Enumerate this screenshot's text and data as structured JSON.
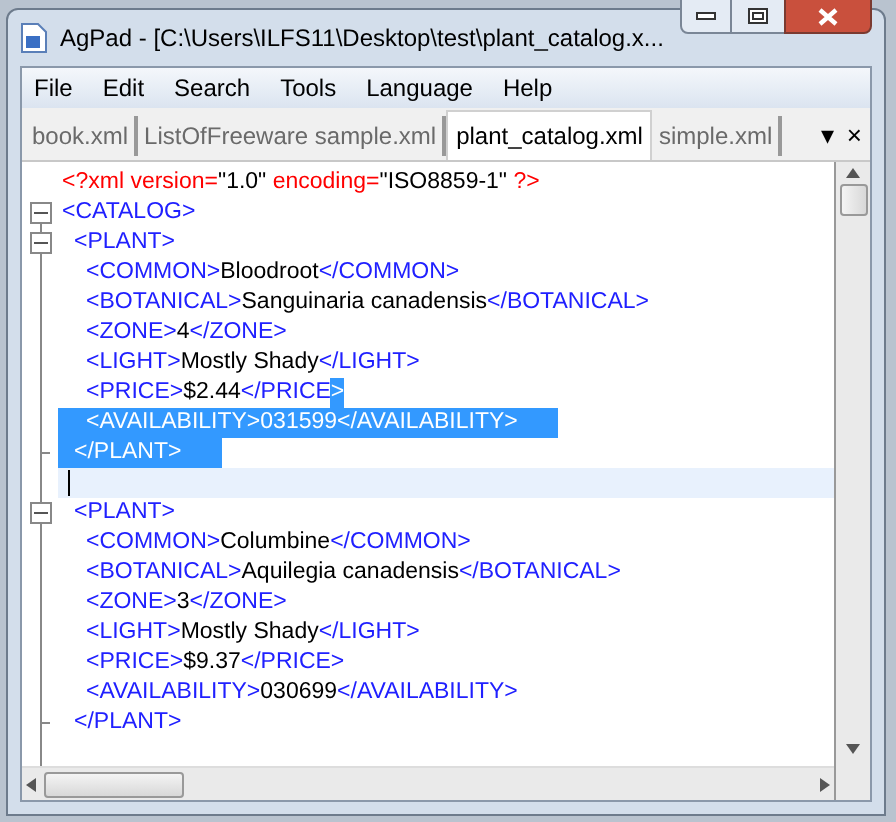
{
  "window": {
    "title": "AgPad - [C:\\Users\\ILFS11\\Desktop\\test\\plant_catalog.x..."
  },
  "menu": [
    "File",
    "Edit",
    "Search",
    "Tools",
    "Language",
    "Help"
  ],
  "tabs": [
    {
      "label": "book.xml",
      "selected": false
    },
    {
      "label": "ListOfFreeware sample.xml",
      "selected": false
    },
    {
      "label": "plant_catalog.xml",
      "selected": true
    },
    {
      "label": "simple.xml",
      "selected": false
    }
  ],
  "tab_controls": [
    "▾",
    "×"
  ],
  "editor": {
    "lines": [
      {
        "kind": "declaration",
        "selected": false,
        "tokens": [
          {
            "t": "<?xml version=",
            "kind": "decl",
            "selected": false
          },
          {
            "t": "\"1.0\"",
            "kind": "value",
            "selected": false
          },
          {
            "t": " encoding=",
            "kind": "decl",
            "selected": false
          },
          {
            "t": "\"ISO8859-1\"",
            "kind": "value",
            "selected": false
          },
          {
            "t": " ?>",
            "kind": "decl",
            "selected": false
          }
        ]
      },
      {
        "kind": "element",
        "expanded": true,
        "selected": false,
        "tokens": [
          {
            "t": "<CATALOG>",
            "kind": "tag",
            "selected": false
          }
        ],
        "children": [
          {
            "kind": "element",
            "expanded": true,
            "selected": false,
            "tokens": [
              {
                "t": "<PLANT>",
                "kind": "tag",
                "selected": false
              }
            ],
            "children": [
              {
                "kind": "line",
                "selected": false,
                "tokens": [
                  {
                    "t": "<COMMON>",
                    "kind": "tag",
                    "selected": false
                  },
                  {
                    "t": "Bloodroot",
                    "kind": "text",
                    "selected": false
                  },
                  {
                    "t": "</COMMON>",
                    "kind": "tag",
                    "selected": false
                  }
                ]
              },
              {
                "kind": "line",
                "selected": false,
                "tokens": [
                  {
                    "t": "<BOTANICAL>",
                    "kind": "tag",
                    "selected": false
                  },
                  {
                    "t": "Sanguinaria canadensis",
                    "kind": "text",
                    "selected": false
                  },
                  {
                    "t": "</BOTANICAL>",
                    "kind": "tag",
                    "selected": false
                  }
                ]
              },
              {
                "kind": "line",
                "selected": false,
                "tokens": [
                  {
                    "t": "<ZONE>",
                    "kind": "tag",
                    "selected": false
                  },
                  {
                    "t": "4",
                    "kind": "text",
                    "selected": false
                  },
                  {
                    "t": "</ZONE>",
                    "kind": "tag",
                    "selected": false
                  }
                ]
              },
              {
                "kind": "line",
                "selected": false,
                "tokens": [
                  {
                    "t": "<LIGHT>",
                    "kind": "tag",
                    "selected": false
                  },
                  {
                    "t": "Mostly Shady",
                    "kind": "text",
                    "selected": false
                  },
                  {
                    "t": "</LIGHT>",
                    "kind": "tag",
                    "selected": false
                  }
                ]
              },
              {
                "kind": "line",
                "selected": false,
                "tokens": [
                  {
                    "t": "<PRICE>",
                    "kind": "tag",
                    "selected": false
                  },
                  {
                    "t": "$2.44",
                    "kind": "text",
                    "selected": false
                  },
                  {
                    "t": "</PRICE",
                    "kind": "tag",
                    "selected": false
                  },
                  {
                    "t": ">",
                    "kind": "tag",
                    "selected": true
                  }
                ]
              },
              {
                "kind": "line",
                "selected": true,
                "tokens": [
                  {
                    "t": "<AVAILABILITY>031599</AVAILABILITY>",
                    "kind": "tag",
                    "selected": true
                  }
                ]
              },
              {
                "kind": "close",
                "selected": true,
                "tokens": [
                  {
                    "t": "</PLANT>",
                    "kind": "tag",
                    "selected": true
                  }
                ]
              }
            ]
          },
          {
            "kind": "blank",
            "current": true
          },
          {
            "kind": "element",
            "expanded": true,
            "selected": false,
            "tokens": [
              {
                "t": "<PLANT>",
                "kind": "tag",
                "selected": false
              }
            ],
            "children": [
              {
                "kind": "line",
                "selected": false,
                "tokens": [
                  {
                    "t": "<COMMON>",
                    "kind": "tag",
                    "selected": false
                  },
                  {
                    "t": "Columbine",
                    "kind": "text",
                    "selected": false
                  },
                  {
                    "t": "</COMMON>",
                    "kind": "tag",
                    "selected": false
                  }
                ]
              },
              {
                "kind": "line",
                "selected": false,
                "tokens": [
                  {
                    "t": "<BOTANICAL>",
                    "kind": "tag",
                    "selected": false
                  },
                  {
                    "t": "Aquilegia canadensis",
                    "kind": "text",
                    "selected": false
                  },
                  {
                    "t": "</BOTANICAL>",
                    "kind": "tag",
                    "selected": false
                  }
                ]
              },
              {
                "kind": "line",
                "selected": false,
                "tokens": [
                  {
                    "t": "<ZONE>",
                    "kind": "tag",
                    "selected": false
                  },
                  {
                    "t": "3",
                    "kind": "text",
                    "selected": false
                  },
                  {
                    "t": "</ZONE>",
                    "kind": "tag",
                    "selected": false
                  }
                ]
              },
              {
                "kind": "line",
                "selected": false,
                "tokens": [
                  {
                    "t": "<LIGHT>",
                    "kind": "tag",
                    "selected": false
                  },
                  {
                    "t": "Mostly Shady",
                    "kind": "text",
                    "selected": false
                  },
                  {
                    "t": "</LIGHT>",
                    "kind": "tag",
                    "selected": false
                  }
                ]
              },
              {
                "kind": "line",
                "selected": false,
                "tokens": [
                  {
                    "t": "<PRICE>",
                    "kind": "tag",
                    "selected": false
                  },
                  {
                    "t": "$9.37",
                    "kind": "text",
                    "selected": false
                  },
                  {
                    "t": "</PRICE>",
                    "kind": "tag",
                    "selected": false
                  }
                ]
              },
              {
                "kind": "line",
                "selected": false,
                "tokens": [
                  {
                    "t": "<AVAILABILITY>",
                    "kind": "tag",
                    "selected": false
                  },
                  {
                    "t": "030699",
                    "kind": "text",
                    "selected": false
                  },
                  {
                    "t": "</AVAILABILITY>",
                    "kind": "tag",
                    "selected": false
                  }
                ]
              },
              {
                "kind": "close",
                "selected": false,
                "tokens": [
                  {
                    "t": "</PLANT>",
                    "kind": "tag",
                    "selected": false
                  }
                ]
              }
            ]
          }
        ]
      }
    ]
  }
}
